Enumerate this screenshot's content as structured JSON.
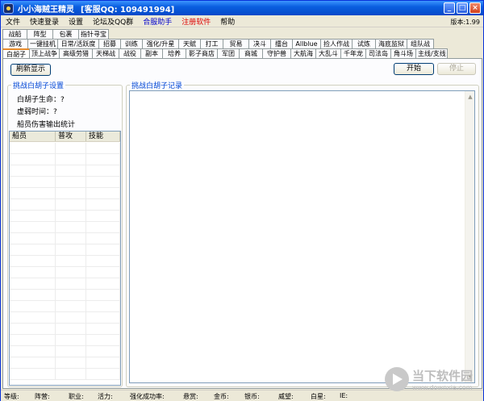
{
  "window": {
    "title": "小小海贼王精灵",
    "contact": "[客服QQ: 109491994]",
    "min_glyph": "_",
    "max_glyph": "□",
    "close_glyph": "×"
  },
  "menu": {
    "items": [
      {
        "label": "文件",
        "style": "normal"
      },
      {
        "label": "快速登录",
        "style": "normal"
      },
      {
        "label": "设置",
        "style": "normal"
      },
      {
        "label": "论坛及QQ群",
        "style": "normal"
      },
      {
        "label": "合服助手",
        "style": "blue"
      },
      {
        "label": "注册软件",
        "style": "red"
      },
      {
        "label": "帮助",
        "style": "normal"
      }
    ],
    "version": "版本:1.99"
  },
  "tabs": {
    "row1": [
      "战船",
      "阵型",
      "包裹",
      "指针寻宝"
    ],
    "row2": [
      "游戏",
      "一键挂机",
      "日常/活跃度",
      "招募",
      "训练",
      "强化/升星",
      "天赋",
      "打工",
      "贸易",
      "决斗",
      "擂台",
      "Allblue",
      "捡人作战",
      "试炼",
      "海底监狱",
      "组队战"
    ],
    "row3": [
      "白胡子",
      "顶上战争",
      "高级劳猎",
      "天梯战",
      "战役",
      "副本",
      "培养",
      "影子商店",
      "军团",
      "商城",
      "守护兽",
      "大航海",
      "大乱斗",
      "千年龙",
      "司法岛",
      "角斗场",
      "主线/支线"
    ],
    "active": "白胡子"
  },
  "buttons": {
    "refresh": "刷新显示",
    "start": "开始",
    "stop": "停止"
  },
  "settings": {
    "title": "挑战白胡子设置",
    "life_label": "白胡子生命：",
    "life_value": "?",
    "weak_time_label": "虚弱时间：",
    "weak_time_value": "?",
    "damage_stats_label": "船员伤害输出统计"
  },
  "damage_table": {
    "columns": [
      "船员",
      "普攻",
      "技能"
    ],
    "rows": []
  },
  "log": {
    "title": "挑战白胡子记录",
    "scroll_up": "▲",
    "scroll_down": "▼"
  },
  "status": {
    "items": [
      "等级:",
      "阵营:",
      "职业:",
      "活力:",
      "强化成功率:",
      "悬赏:",
      "金币:",
      "银币:",
      "威望:",
      "白星:",
      "IE:"
    ]
  },
  "watermark": {
    "cn": "当下软件园",
    "en": "www.downxia.com"
  }
}
